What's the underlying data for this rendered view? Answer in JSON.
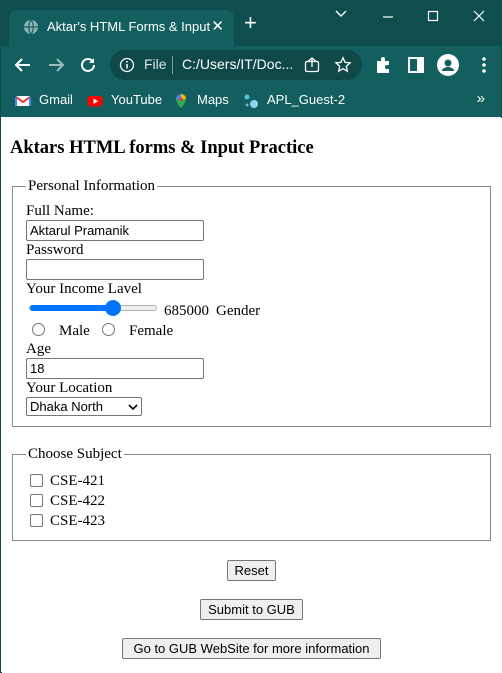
{
  "browser": {
    "tab_title": "Aktar's HTML Forms & Input",
    "tab_close": "✕",
    "new_tab": "+",
    "address_scheme": "File",
    "address_url": "C:/Users/IT/Doc...",
    "bookmarks": [
      {
        "label": "Gmail",
        "icon": "gmail-icon"
      },
      {
        "label": "YouTube",
        "icon": "youtube-icon"
      },
      {
        "label": "Maps",
        "icon": "maps-icon"
      },
      {
        "label": "APL_Guest-2",
        "icon": "apl-icon"
      }
    ],
    "bookmarks_more": "»",
    "colors": {
      "frame": "#0f4e4e",
      "toolbar": "#135f5f",
      "accent": "#0075ff"
    }
  },
  "page": {
    "heading": "Aktars HTML forms & Input Practice",
    "personal": {
      "legend": "Personal Information",
      "full_name_label": "Full Name:",
      "full_name_value": "Aktarul Pramanik",
      "password_label": "Password",
      "password_value": "",
      "income_label": "Your Income Lavel",
      "income_value": "685000",
      "income_fraction": 0.68,
      "gender_label": "Gender",
      "male_label": "Male",
      "female_label": "Female",
      "age_label": "Age",
      "age_value": "18",
      "location_label": "Your Location",
      "location_selected": "Dhaka North"
    },
    "subjects": {
      "legend": "Choose Subject",
      "items": [
        "CSE-421",
        "CSE-422",
        "CSE-423"
      ]
    },
    "buttons": {
      "reset": "Reset",
      "submit": "Submit to GUB",
      "goto": "Go to GUB WebSite for more information"
    }
  }
}
